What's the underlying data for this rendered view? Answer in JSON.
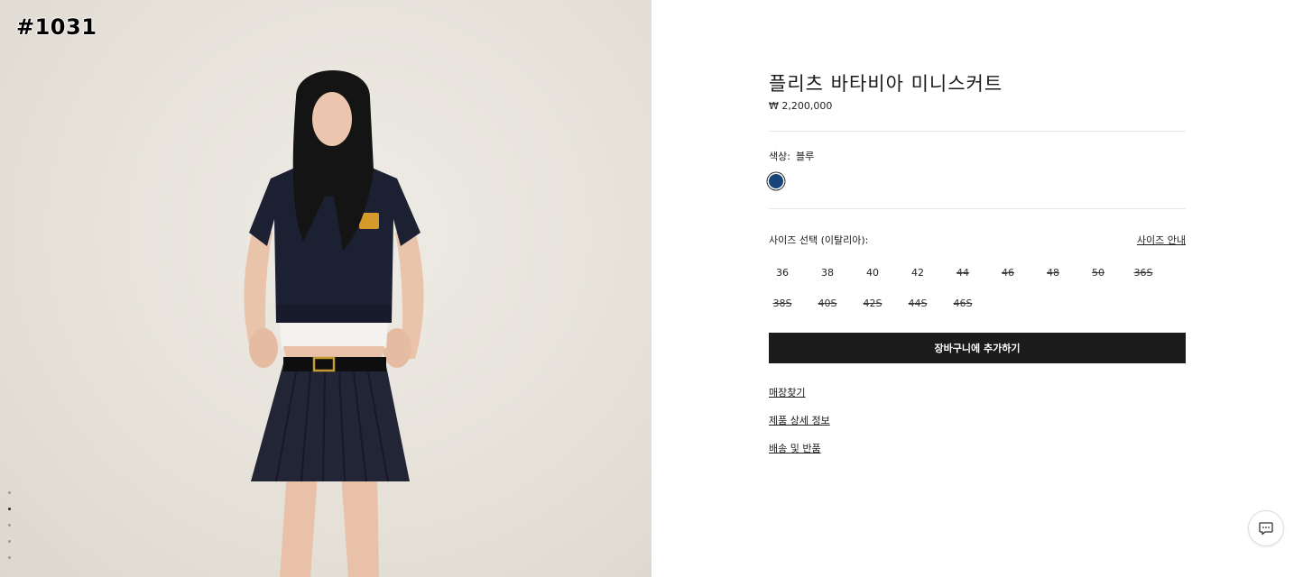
{
  "sticker": "#1031",
  "product": {
    "title": "플리츠 바타비아 미니스커트",
    "price": "₩ 2,200,000"
  },
  "color": {
    "label": "색상:",
    "value": "블루",
    "swatch_hex": "#17447a"
  },
  "size": {
    "label": "사이즈 선택 (이탈리아):",
    "guide_link": "사이즈 안내",
    "options": [
      {
        "label": "36",
        "available": true
      },
      {
        "label": "38",
        "available": true
      },
      {
        "label": "40",
        "available": true
      },
      {
        "label": "42",
        "available": true
      },
      {
        "label": "44",
        "available": false
      },
      {
        "label": "46",
        "available": false
      },
      {
        "label": "48",
        "available": false
      },
      {
        "label": "50",
        "available": false
      },
      {
        "label": "36S",
        "available": false
      },
      {
        "label": "38S",
        "available": false
      },
      {
        "label": "40S",
        "available": false
      },
      {
        "label": "42S",
        "available": false
      },
      {
        "label": "44S",
        "available": false
      },
      {
        "label": "46S",
        "available": false
      }
    ]
  },
  "cart_button": "장바구니에 추가하기",
  "links": [
    "매장찾기",
    "제품 상세 정보",
    "배송 및 반품"
  ],
  "gallery": {
    "count": 5,
    "active_index": 1
  },
  "icons": {
    "chat": "chat-bubble-icon"
  }
}
